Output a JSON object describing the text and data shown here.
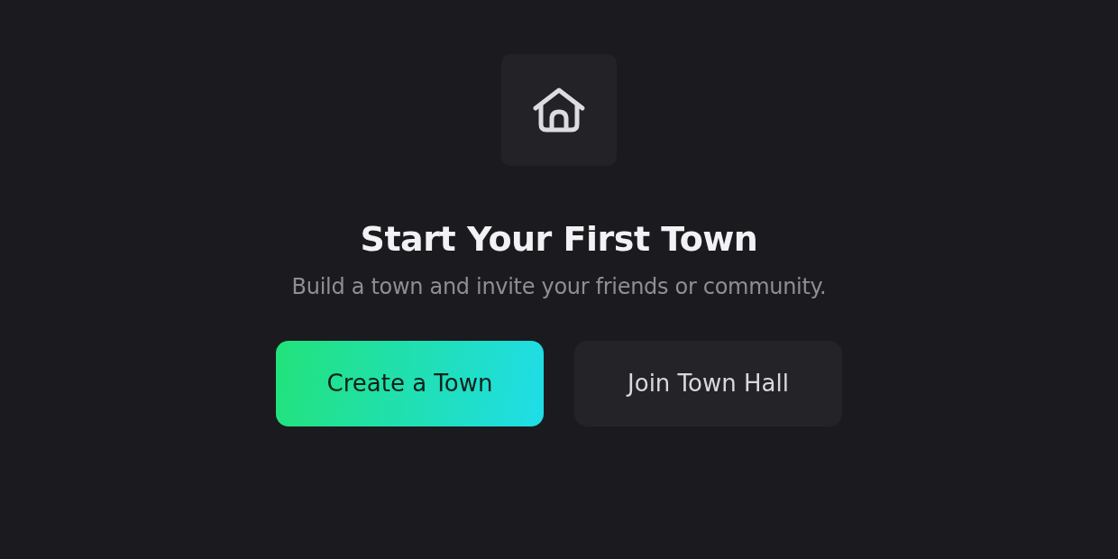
{
  "title": "Start Your First Town",
  "subtitle": "Build a town and invite your friends or community.",
  "buttons": [
    {
      "label": "Create a Town",
      "kind": "primary"
    },
    {
      "label": "Join Town Hall",
      "kind": "secondary"
    }
  ]
}
